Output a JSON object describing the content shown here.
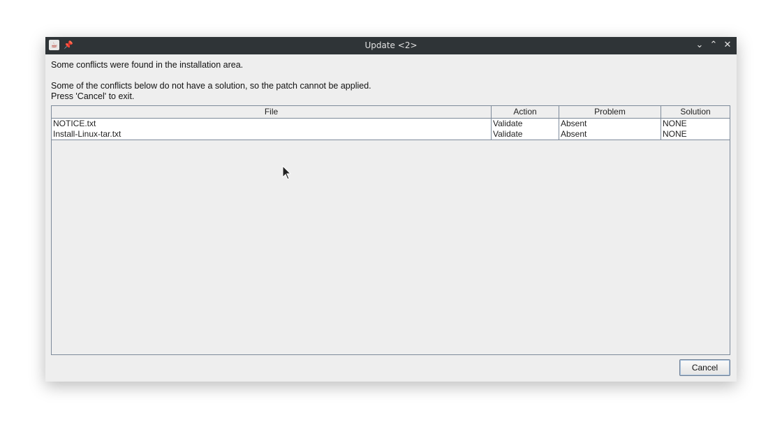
{
  "window": {
    "title": "Update <2>",
    "controls": {
      "minimize": "⌄",
      "maximize": "⌃",
      "close": "✕"
    }
  },
  "messages": {
    "line1": "Some conflicts were found in the installation area.",
    "line2": "Some of the conflicts below do not have a solution, so the patch cannot be applied.",
    "line3": "Press 'Cancel' to exit."
  },
  "table": {
    "columns": [
      "File",
      "Action",
      "Problem",
      "Solution"
    ],
    "rows": [
      [
        "NOTICE.txt",
        "Validate",
        "Absent",
        "NONE"
      ],
      [
        "Install-Linux-tar.txt",
        "Validate",
        "Absent",
        "NONE"
      ]
    ]
  },
  "buttons": {
    "cancel": "Cancel"
  },
  "icons": {
    "app": "java-app-icon",
    "pin": "pin-icon",
    "cursor": "mouse-pointer-icon"
  },
  "colors": {
    "titlebar": "#2f3437",
    "window_bg": "#eeeeee",
    "grid": "#7d8a9a"
  }
}
